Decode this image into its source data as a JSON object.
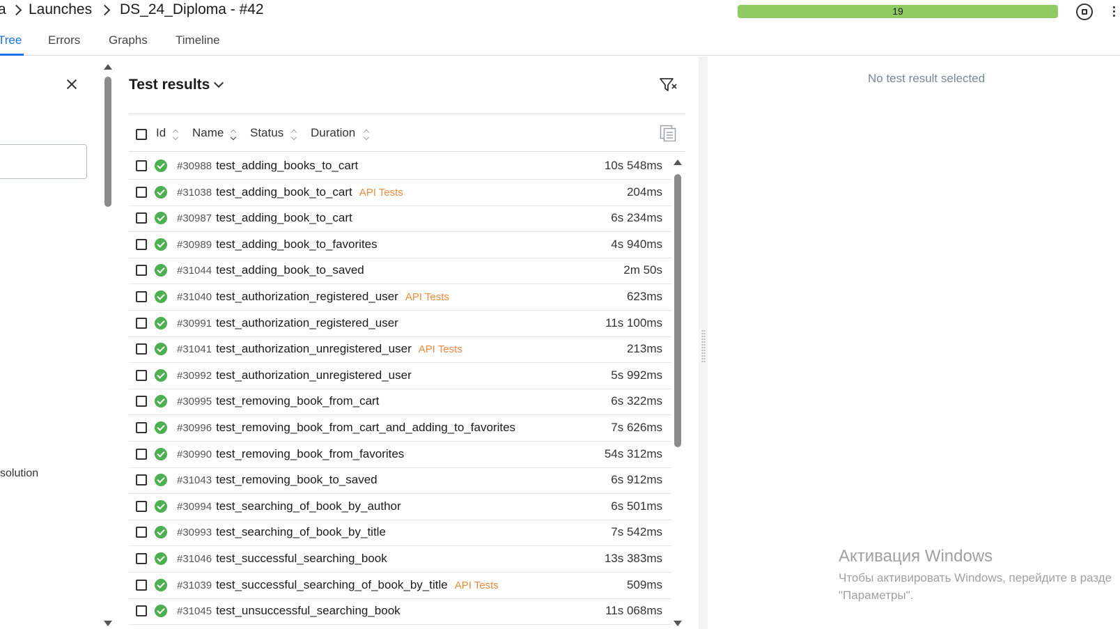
{
  "header": {
    "breadcrumb": [
      "a",
      "Launches",
      "DS_24_Diploma - #42"
    ],
    "progress_count": "19",
    "progress_fraction": 1.0,
    "progress_color": "#8fcb62"
  },
  "tabs": [
    {
      "label": "Tree",
      "active": true
    },
    {
      "label": "Errors",
      "active": false
    },
    {
      "label": "Graphs",
      "active": false
    },
    {
      "label": "Timeline",
      "active": false
    }
  ],
  "left_panel": {
    "partial_text": "solution"
  },
  "results": {
    "title": "Test results",
    "columns": [
      "Id",
      "Name",
      "Status",
      "Duration"
    ],
    "rows": [
      {
        "id": "#30988",
        "name": "test_adding_books_to_cart",
        "tag": "",
        "duration": "10s 548ms",
        "status": "passed"
      },
      {
        "id": "#31038",
        "name": "test_adding_book_to_cart",
        "tag": "API Tests",
        "duration": "204ms",
        "status": "passed"
      },
      {
        "id": "#30987",
        "name": "test_adding_book_to_cart",
        "tag": "",
        "duration": "6s 234ms",
        "status": "passed"
      },
      {
        "id": "#30989",
        "name": "test_adding_book_to_favorites",
        "tag": "",
        "duration": "4s 940ms",
        "status": "passed"
      },
      {
        "id": "#31044",
        "name": "test_adding_book_to_saved",
        "tag": "",
        "duration": "2m 50s",
        "status": "passed"
      },
      {
        "id": "#31040",
        "name": "test_authorization_registered_user",
        "tag": "API Tests",
        "duration": "623ms",
        "status": "passed"
      },
      {
        "id": "#30991",
        "name": "test_authorization_registered_user",
        "tag": "",
        "duration": "11s 100ms",
        "status": "passed"
      },
      {
        "id": "#31041",
        "name": "test_authorization_unregistered_user",
        "tag": "API Tests",
        "duration": "213ms",
        "status": "passed"
      },
      {
        "id": "#30992",
        "name": "test_authorization_unregistered_user",
        "tag": "",
        "duration": "5s 992ms",
        "status": "passed"
      },
      {
        "id": "#30995",
        "name": "test_removing_book_from_cart",
        "tag": "",
        "duration": "6s 322ms",
        "status": "passed"
      },
      {
        "id": "#30996",
        "name": "test_removing_book_from_cart_and_adding_to_favorites",
        "tag": "",
        "duration": "7s 626ms",
        "status": "passed"
      },
      {
        "id": "#30990",
        "name": "test_removing_book_from_favorites",
        "tag": "",
        "duration": "54s 312ms",
        "status": "passed"
      },
      {
        "id": "#31043",
        "name": "test_removing_book_to_saved",
        "tag": "",
        "duration": "6s 912ms",
        "status": "passed"
      },
      {
        "id": "#30994",
        "name": "test_searching_of_book_by_author",
        "tag": "",
        "duration": "6s 501ms",
        "status": "passed"
      },
      {
        "id": "#30993",
        "name": "test_searching_of_book_by_title",
        "tag": "",
        "duration": "7s 542ms",
        "status": "passed"
      },
      {
        "id": "#31046",
        "name": "test_successful_searching_book",
        "tag": "",
        "duration": "13s 383ms",
        "status": "passed"
      },
      {
        "id": "#31039",
        "name": "test_successful_searching_of_book_by_title",
        "tag": "API Tests",
        "duration": "509ms",
        "status": "passed"
      },
      {
        "id": "#31045",
        "name": "test_unsuccessful_searching_book",
        "tag": "",
        "duration": "11s 068ms",
        "status": "passed"
      }
    ]
  },
  "detail": {
    "empty_message": "No test result selected"
  },
  "watermark": {
    "title": "Активация Windows",
    "line1": "Чтобы активировать Windows, перейдите в разде",
    "line2": "\"Параметры\"."
  },
  "colors": {
    "accent": "#1a73e8",
    "passed": "#4caf50",
    "tag": "#f0893b"
  }
}
